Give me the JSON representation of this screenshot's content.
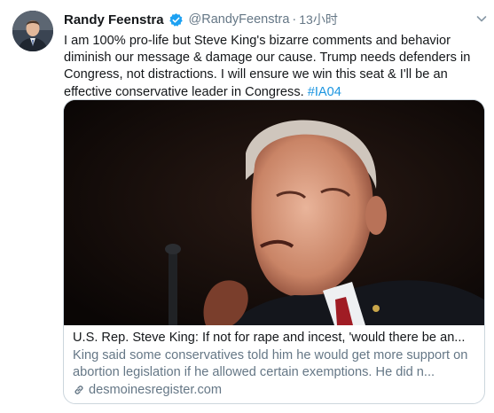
{
  "tweet": {
    "author_name": "Randy Feenstra",
    "handle": "@RandyFeenstra",
    "separator": "·",
    "time": "13小时",
    "text": "I am 100% pro-life but Steve King's bizarre comments and behavior diminish our message & damage our cause. Trump needs defenders in Congress, not distractions. I will ensure we win this seat & I'll be an effective conservative leader in Congress. ",
    "hashtag": "#IA04"
  },
  "card": {
    "title": "U.S. Rep. Steve King: If not for rape and incest, 'would there be an...",
    "description": "King said some conservatives told him he would get more support on abortion legislation if he allowed certain exemptions. He did n...",
    "domain": "desmoinesregister.com"
  },
  "icons": {
    "verified": "verified-badge-icon",
    "menu": "chevron-down-icon",
    "link": "link-icon"
  },
  "colors": {
    "accent": "#1da1f2",
    "hashtag": "#1b95e0",
    "muted": "#657786"
  }
}
